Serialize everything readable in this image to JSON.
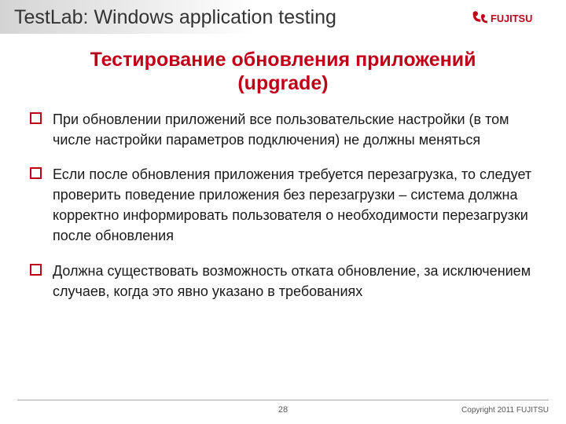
{
  "header": {
    "title": "TestLab: Windows application testing",
    "logo_text": "FUJITSU"
  },
  "subtitle_line1": "Тестирование обновления приложений",
  "subtitle_line2": "(upgrade)",
  "bullets": [
    "При обновлении приложений все пользовательские настройки (в том числе настройки параметров подключения) не должны меняться",
    "Если после обновления приложения требуется перезагрузка, то следует проверить поведение приложения без перезагрузки – система должна корректно информировать пользователя о необходимости перезагрузки после обновления",
    "Должна существовать возможность отката обновление, за исключением случаев, когда это явно указано в требованиях"
  ],
  "footer": {
    "page": "28",
    "copyright": "Copyright 2011 FUJITSU"
  },
  "colors": {
    "accent": "#c00019"
  }
}
